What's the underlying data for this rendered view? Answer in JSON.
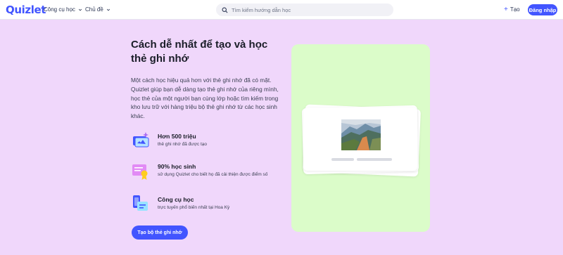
{
  "header": {
    "logo": "Quizlet",
    "nav": [
      {
        "label": "Công cụ học"
      },
      {
        "label": "Chủ đề"
      }
    ],
    "search_placeholder": "Tìm kiếm hướng dẫn học",
    "create_label": "Tạo",
    "login_label": "Đăng nhập"
  },
  "hero": {
    "title": "Cách dễ nhất để tạo và học thẻ ghi nhớ",
    "description": "Một cách học hiệu quả hơn với thẻ ghi nhớ đã có mặt. Quizlet giúp bạn dễ dàng tạo thẻ ghi nhớ của riêng mình, học thẻ của một người bạn cùng lớp hoặc tìm kiếm trong kho lưu trữ với hàng triệu bộ thẻ ghi nhớ từ các học sinh khác.",
    "features": [
      {
        "title": "Hơn 500 triệu",
        "subtitle": "thẻ ghi nhớ đã được tạo",
        "icon": "flashcards-icon"
      },
      {
        "title": "90% học sinh",
        "subtitle": "sử dụng Quizlet cho biết họ đã cải thiện được điểm số",
        "icon": "certificate-icon"
      },
      {
        "title": "Công cụ học",
        "subtitle": "trực tuyến phổ biến nhất tại Hoa Kỳ",
        "icon": "study-tools-icon"
      }
    ],
    "cta_label": "Tạo bộ thẻ ghi nhớ"
  },
  "colors": {
    "brand": "#4255ff",
    "page_background": "#f0d7fb",
    "panel_background": "#dbfcc9"
  }
}
